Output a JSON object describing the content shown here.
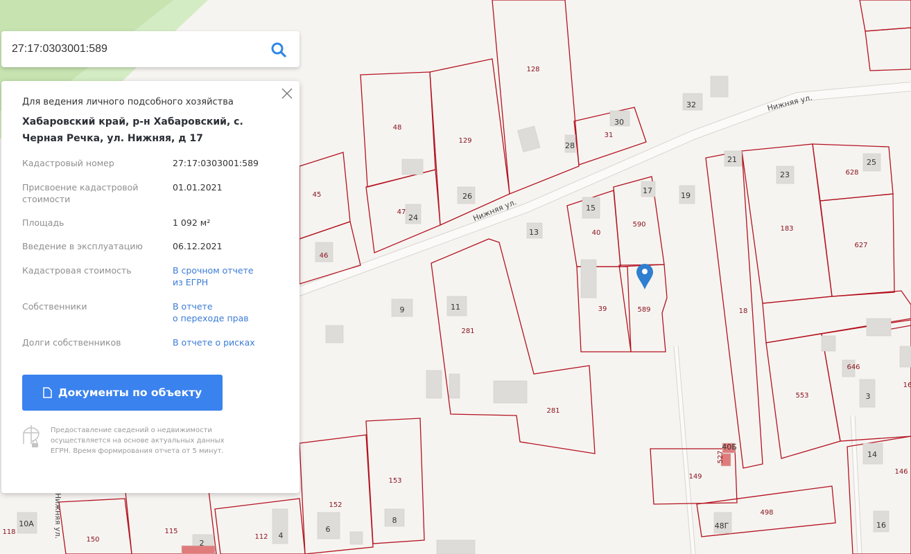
{
  "search": {
    "value": "27:17:0303001:589",
    "button": "search-icon"
  },
  "panel": {
    "purpose": "Для ведения личного подсобного хозяйства",
    "address": "Хабаровский край, р-н Хабаровский, с. Черная Речка, ул. Нижняя, д 17",
    "rows": [
      {
        "key": "Кадастровый номер",
        "value": "27:17:0303001:589"
      },
      {
        "key": "Присвоение кадастровой стоимости",
        "value": "01.01.2021"
      },
      {
        "key": "Площадь",
        "value": "1 092 м²"
      },
      {
        "key": "Введение в эксплуатацию",
        "value": "06.12.2021"
      },
      {
        "key": "Кадастровая стоимость",
        "link1": "В срочном отчете",
        "link2": "из ЕГРН"
      },
      {
        "key": "Собственники",
        "link1": "В отчете",
        "link2": "о переходе прав"
      },
      {
        "key": "Долги собственников",
        "link1": "В отчете о рисках"
      }
    ],
    "doc_button": "Документы по объекту",
    "note": "Предоставление сведений о недвижимости осуществляется на основе актуальных данных ЕГРН. Время формирования отчета от 5 минут."
  },
  "map": {
    "streets": [
      "Нижняя ул.",
      "Нижняя ул.",
      "Нижняя ул."
    ],
    "labels": [
      "128",
      "48",
      "129",
      "30",
      "31",
      "28",
      "32",
      "45",
      "47",
      "24",
      "26",
      "13",
      "15",
      "17",
      "19",
      "40",
      "590",
      "21",
      "23",
      "628",
      "25",
      "183",
      "627",
      "46",
      "9",
      "11",
      "281",
      "39",
      "589",
      "18",
      "646",
      "553",
      "3",
      "16",
      "281",
      "153",
      "8",
      "152",
      "6",
      "4",
      "112",
      "115",
      "150",
      "118",
      "10А",
      "149",
      "498",
      "48Г",
      "14",
      "146",
      "16",
      "2",
      "40Б",
      "527"
    ],
    "colors": {
      "parcel": "#b3121f",
      "marker": "#2f7fd0",
      "accent": "#3a82ee"
    }
  }
}
